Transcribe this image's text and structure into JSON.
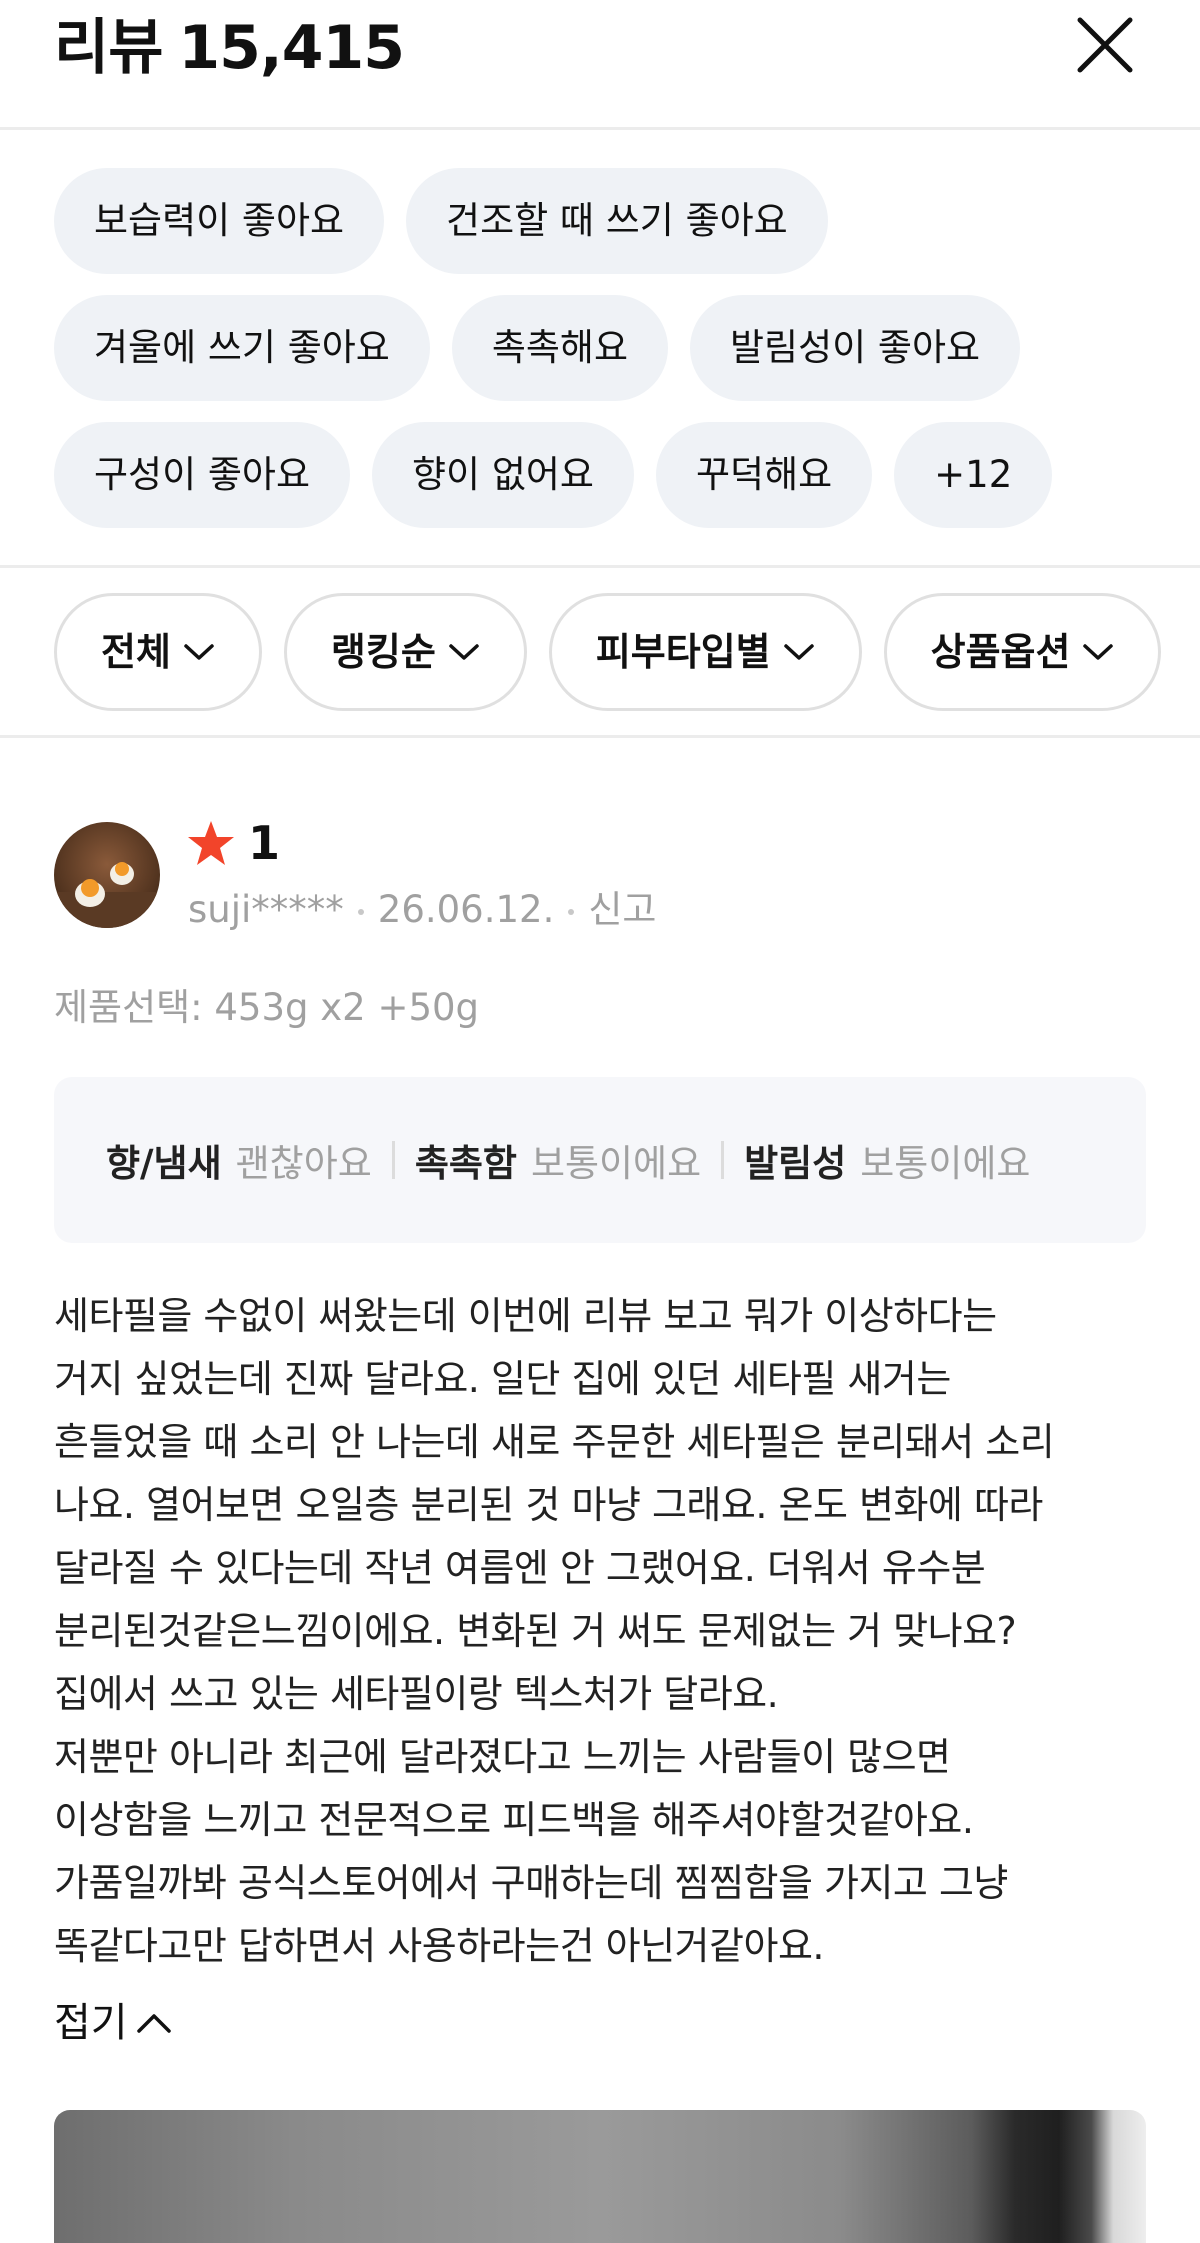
{
  "header": {
    "title": "리뷰",
    "count": "15,415"
  },
  "keywords": {
    "rows": [
      [
        "보습력이 좋아요",
        "건조할 때 쓰기 좋아요"
      ],
      [
        "겨울에 쓰기 좋아요",
        "촉촉해요",
        "발림성이 좋아요"
      ],
      [
        "구성이 좋아요",
        "향이 없어요",
        "꾸덕해요",
        "+12"
      ]
    ]
  },
  "filters": [
    "전체",
    "랭킹순",
    "피부타입별",
    "상품옵션"
  ],
  "review": {
    "rating": "1",
    "star_color": "#f2442a",
    "user": "suji*****",
    "date": "26.06.12.",
    "report": "신고",
    "option": "제품선택: 453g x2 +50g",
    "attributes": [
      {
        "key": "향/냄새",
        "value": "괜찮아요"
      },
      {
        "key": "촉촉함",
        "value": "보통이에요"
      },
      {
        "key": "발림성",
        "value": "보통이에요"
      }
    ],
    "text_lines": [
      "세타필을 수없이 써왔는데 이번에 리뷰 보고 뭐가 이상하다는",
      "거지 싶었는데 진짜 달라요. 일단 집에 있던 세타필 새거는",
      "흔들었을 때 소리 안 나는데 새로 주문한 세타필은 분리돼서 소리",
      "나요. 열어보면 오일층 분리된 것 마냥 그래요. 온도 변화에 따라",
      "달라질 수 있다는데 작년 여름엔 안 그랬어요. 더워서 유수분",
      "분리된것같은느낌이에요. 변화된 거 써도 문제없는 거 맞나요?",
      "집에서 쓰고 있는 세타필이랑 텍스처가 달라요.",
      "저뿐만 아니라 최근에 달라졌다고 느끼는 사람들이 많으면",
      "이상함을 느끼고 전문적으로 피드백을 해주셔야할것같아요.",
      "가품일까봐 공식스토어에서 구매하는데 찜찜함을 가지고 그냥",
      "똑같다고만 답하면서 사용하라는건 아닌거같아요."
    ],
    "collapse_label": "접기"
  },
  "icons": {
    "close": "close-icon",
    "chevron": "chevron-down-icon",
    "star": "star-icon",
    "collapse": "chevron-up-icon"
  }
}
